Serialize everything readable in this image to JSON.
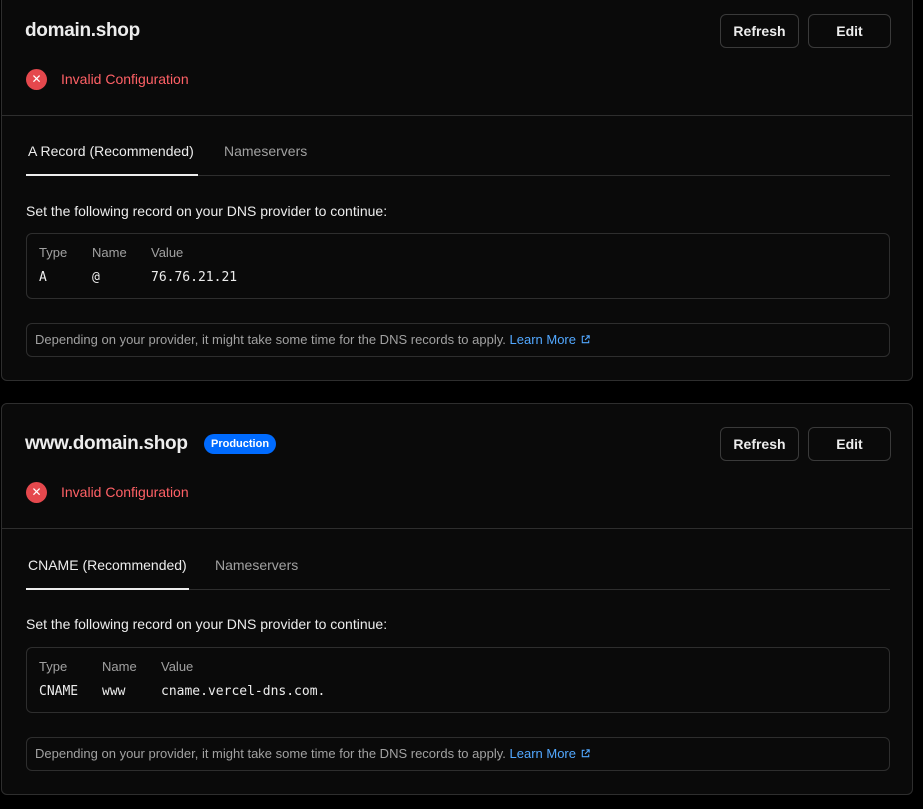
{
  "colors": {
    "background": "#000000",
    "card": "#0a0a0a",
    "border": "#2e2e2e",
    "error": "#e5484d",
    "link": "#52a8ff",
    "badge": "#006bff"
  },
  "icons": {
    "status": "x-circle-icon",
    "external_link": "external-link-icon"
  },
  "domains": [
    {
      "title": "domain.shop",
      "badge": "",
      "refresh_label": "Refresh",
      "edit_label": "Edit",
      "status": "Invalid Configuration",
      "tabs": [
        {
          "label": "A Record (Recommended)",
          "active": true
        },
        {
          "label": "Nameservers",
          "active": false
        }
      ],
      "instruction": "Set the following record on your DNS provider to continue:",
      "record_headers": [
        "Type",
        "Name",
        "Value"
      ],
      "record_values": [
        "A",
        "@",
        "76.76.21.21"
      ],
      "note": "Depending on your provider, it might take some time for the DNS records to apply.",
      "learn_more": "Learn More"
    },
    {
      "title": "www.domain.shop",
      "badge": "Production",
      "refresh_label": "Refresh",
      "edit_label": "Edit",
      "status": "Invalid Configuration",
      "tabs": [
        {
          "label": "CNAME (Recommended)",
          "active": true
        },
        {
          "label": "Nameservers",
          "active": false
        }
      ],
      "instruction": "Set the following record on your DNS provider to continue:",
      "record_headers": [
        "Type",
        "Name",
        "Value"
      ],
      "record_values": [
        "CNAME",
        "www",
        "cname.vercel-dns.com."
      ],
      "note": "Depending on your provider, it might take some time for the DNS records to apply.",
      "learn_more": "Learn More"
    }
  ]
}
